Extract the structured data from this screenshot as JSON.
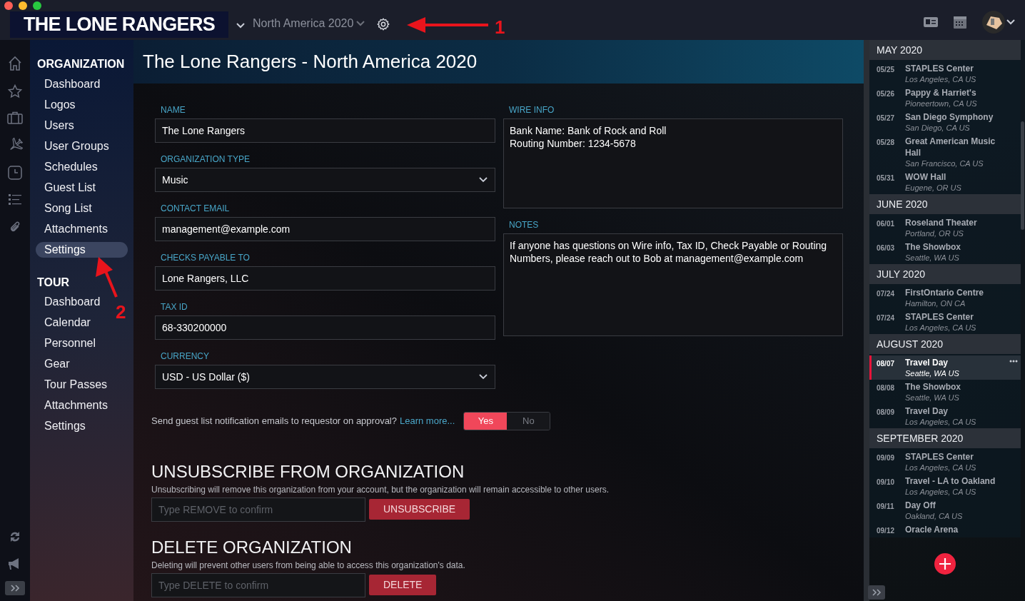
{
  "app": {
    "logo": "THE LONE RANGERS",
    "tour_selector": "North America 2020"
  },
  "annotations": [
    {
      "label": "1"
    },
    {
      "label": "2"
    }
  ],
  "nav": [
    {
      "heading": "ORGANIZATION",
      "items": [
        {
          "label": "Dashboard",
          "selected": false
        },
        {
          "label": "Logos",
          "selected": false
        },
        {
          "label": "Users",
          "selected": false
        },
        {
          "label": "User Groups",
          "selected": false
        },
        {
          "label": "Schedules",
          "selected": false
        },
        {
          "label": "Guest List",
          "selected": false
        },
        {
          "label": "Song List",
          "selected": false
        },
        {
          "label": "Attachments",
          "selected": false
        },
        {
          "label": "Settings",
          "selected": true
        }
      ]
    },
    {
      "heading": "TOUR",
      "items": [
        {
          "label": "Dashboard",
          "selected": false
        },
        {
          "label": "Calendar",
          "selected": false
        },
        {
          "label": "Personnel",
          "selected": false
        },
        {
          "label": "Gear",
          "selected": false
        },
        {
          "label": "Tour Passes",
          "selected": false
        },
        {
          "label": "Attachments",
          "selected": false
        },
        {
          "label": "Settings",
          "selected": false
        }
      ]
    }
  ],
  "page_title": "The Lone Rangers - North America 2020",
  "form": {
    "left": [
      {
        "label": "NAME",
        "kind": "text",
        "value": "The Lone Rangers"
      },
      {
        "label": "ORGANIZATION TYPE",
        "kind": "select",
        "value": "Music"
      },
      {
        "label": "CONTACT EMAIL",
        "kind": "text",
        "value": "management@example.com"
      },
      {
        "label": "CHECKS PAYABLE TO",
        "kind": "text",
        "value": "Lone Rangers, LLC"
      },
      {
        "label": "TAX ID",
        "kind": "text",
        "value": "68-330200000"
      },
      {
        "label": "CURRENCY",
        "kind": "select",
        "value": "USD - US Dollar ($)"
      }
    ],
    "right": [
      {
        "label": "WIRE INFO",
        "kind": "textarea",
        "value": "Bank Name: Bank of Rock and Roll\nRouting Number: 1234-5678"
      },
      {
        "label": "NOTES",
        "kind": "textarea",
        "value": "If anyone has questions on Wire info, Tax ID, Check Payable or Routing Numbers, please reach out to Bob at management@example.com"
      }
    ]
  },
  "guest_notification": {
    "question": "Send guest list notification emails to requestor on approval?",
    "link": "Learn more...",
    "options": [
      {
        "label": "Yes",
        "selected": true
      },
      {
        "label": "No",
        "selected": false
      }
    ]
  },
  "danger_sections": [
    {
      "title": "UNSUBSCRIBE FROM ORGANIZATION",
      "description": "Unsubscribing will remove this organization from your account, but the organization will remain accessible to other users.",
      "placeholder": "Type REMOVE to confirm",
      "button": "UNSUBSCRIBE"
    },
    {
      "title": "DELETE ORGANIZATION",
      "description": "Deleting will prevent other users from being able to access this organization's data.",
      "placeholder": "Type DELETE to confirm",
      "button": "DELETE"
    }
  ],
  "schedule": [
    {
      "month": "MAY 2020",
      "events": [
        {
          "date": "05/25",
          "name": "STAPLES Center",
          "location": "Los Angeles, CA US",
          "selected": false
        },
        {
          "date": "05/26",
          "name": "Pappy & Harriet's",
          "location": "Pioneertown, CA US",
          "selected": false
        },
        {
          "date": "05/27",
          "name": "San Diego Symphony",
          "location": "San Diego, CA US",
          "selected": false
        },
        {
          "date": "05/28",
          "name": "Great American Music Hall",
          "location": "San Francisco, CA US",
          "selected": false
        },
        {
          "date": "05/31",
          "name": "WOW Hall",
          "location": "Eugene, OR US",
          "selected": false
        }
      ]
    },
    {
      "month": "JUNE 2020",
      "events": [
        {
          "date": "06/01",
          "name": "Roseland Theater",
          "location": "Portland, OR US",
          "selected": false
        },
        {
          "date": "06/03",
          "name": "The Showbox",
          "location": "Seattle, WA US",
          "selected": false
        }
      ]
    },
    {
      "month": "JULY 2020",
      "events": [
        {
          "date": "07/24",
          "name": "FirstOntario Centre",
          "location": "Hamilton, ON CA",
          "selected": false
        },
        {
          "date": "07/24",
          "name": "STAPLES Center",
          "location": "Los Angeles, CA US",
          "selected": false
        }
      ]
    },
    {
      "month": "AUGUST 2020",
      "events": [
        {
          "date": "08/07",
          "name": "Travel Day",
          "location": "Seattle, WA US",
          "selected": true
        },
        {
          "date": "08/08",
          "name": "The Showbox",
          "location": "Seattle, WA US",
          "selected": false
        },
        {
          "date": "08/09",
          "name": "Travel Day",
          "location": "Los Angeles, CA US",
          "selected": false
        }
      ]
    },
    {
      "month": "SEPTEMBER 2020",
      "events": [
        {
          "date": "09/09",
          "name": "STAPLES Center",
          "location": "Los Angeles, CA US",
          "selected": false
        },
        {
          "date": "09/10",
          "name": "Travel - LA to Oakland",
          "location": "Los Angeles, CA US",
          "selected": false
        },
        {
          "date": "09/11",
          "name": "Day Off",
          "location": "Oakland, CA US",
          "selected": false
        },
        {
          "date": "09/12",
          "name": "Oracle Arena",
          "selected": false
        }
      ]
    }
  ]
}
